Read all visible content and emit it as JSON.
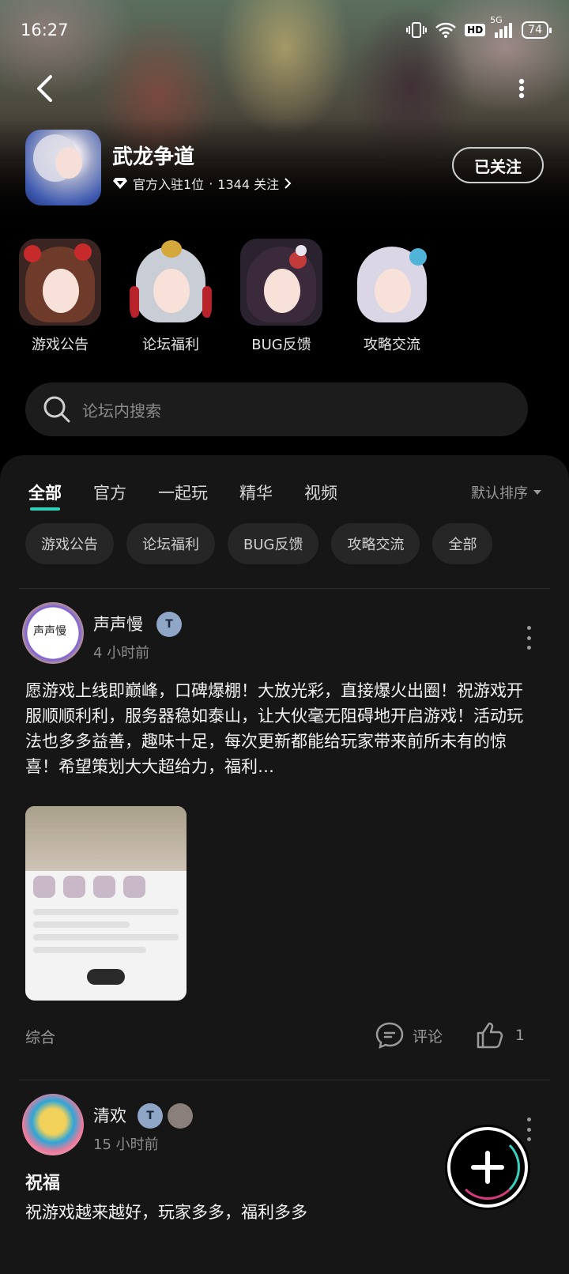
{
  "status_bar": {
    "time": "16:27",
    "network": "5G",
    "hd": "HD",
    "battery": "74"
  },
  "game": {
    "title": "武龙争道",
    "meta_official": "官方入驻1位",
    "meta_dot": "·",
    "meta_follow": "1344 关注",
    "follow_label": "已关注"
  },
  "channels": [
    {
      "label": "游戏公告"
    },
    {
      "label": "论坛福利"
    },
    {
      "label": "BUG反馈"
    },
    {
      "label": "攻略交流"
    }
  ],
  "search": {
    "placeholder": "论坛内搜索"
  },
  "tabs": [
    {
      "label": "全部",
      "active": true
    },
    {
      "label": "官方"
    },
    {
      "label": "一起玩"
    },
    {
      "label": "精华"
    },
    {
      "label": "视频"
    }
  ],
  "sort_label": "默认排序",
  "chips": [
    "游戏公告",
    "论坛福利",
    "BUG反馈",
    "攻略交流",
    "全部"
  ],
  "posts": [
    {
      "user": "声声慢",
      "time": "4 小时前",
      "avatar_text": "声声慢",
      "badge": "T",
      "text": "愿游戏上线即巅峰，口碑爆棚！大放光彩，直接爆火出圈！祝游戏开服顺顺利利，服务器稳如泰山，让大伙毫无阻碍地开启游戏！活动玩法也多多益善，趣味十足，每次更新都能给玩家带来前所未有的惊喜！希望策划大大超给力，福利…",
      "category": "综合",
      "comment_label": "评论",
      "likes": "1"
    },
    {
      "user": "清欢",
      "time": "15 小时前",
      "badge": "T",
      "title": "祝福",
      "text": "祝游戏越来越好，玩家多多，福利多多"
    }
  ],
  "colors": {
    "accent": "#2fd2b6",
    "panel": "#161616",
    "chip": "#262626"
  }
}
